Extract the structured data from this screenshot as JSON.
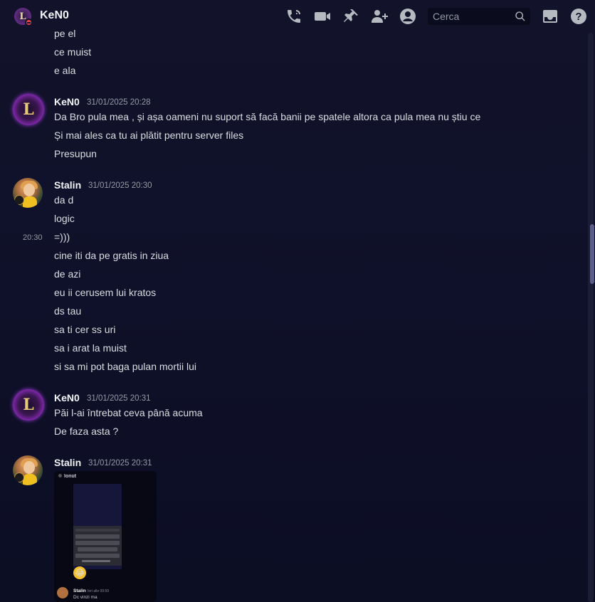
{
  "header": {
    "title": "KeN0",
    "search_placeholder": "Cerca",
    "icons": [
      "voice-call-icon",
      "video-call-icon",
      "pin-icon",
      "add-friends-icon",
      "user-profile-icon",
      "inbox-icon",
      "help-icon"
    ]
  },
  "messages": [
    {
      "continued_lines": [
        "pe el",
        "ce muist",
        "e ala"
      ]
    },
    {
      "author": "KeN0",
      "timestamp": "31/01/2025 20:28",
      "lines": [
        "Da Bro pula mea , și așa oameni nu suport să facă banii pe spatele altora ca pula mea nu știu ce",
        "Și mai ales ca tu ai plătit pentru server files",
        "Presupun"
      ]
    },
    {
      "author": "Stalin",
      "timestamp": "31/01/2025 20:30",
      "hover_time": "20:30",
      "lines": [
        "da d",
        "logic",
        "=)))",
        "cine iti da pe gratis in ziua",
        "de azi",
        "eu ii cerusem lui kratos",
        "ds tau",
        "sa ti cer ss uri",
        "sa i arat la muist",
        "si sa mi pot baga pulan mortii lui"
      ]
    },
    {
      "author": "KeN0",
      "timestamp": "31/01/2025 20:31",
      "lines": [
        "Păi l-ai întrebat ceva până acuma",
        "De faza asta ?"
      ]
    },
    {
      "author": "Stalin",
      "timestamp": "31/01/2025 20:31",
      "attachment": {
        "top_label": "Ionut",
        "author": "Stalin",
        "time": "Ieri alle 09:59",
        "text": "Dc vinzi ma"
      }
    }
  ],
  "colors": {
    "background": "#12132b",
    "text": "#dbdee1",
    "muted": "#949ba4",
    "status_dnd": "#f23f43"
  }
}
